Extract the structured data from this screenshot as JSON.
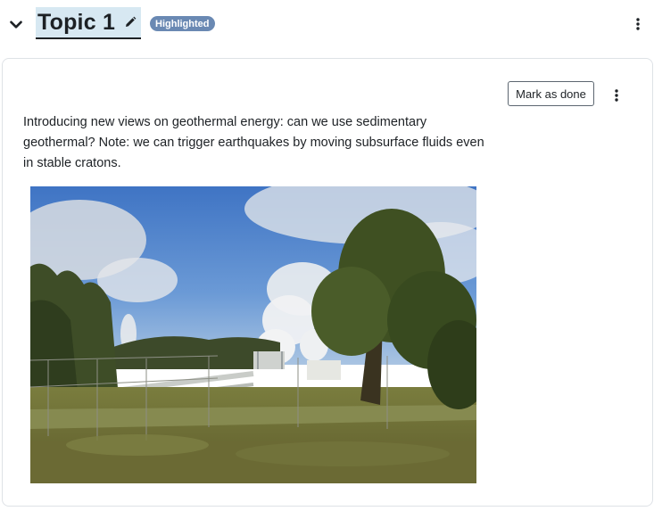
{
  "section": {
    "title": "Topic 1",
    "badge": "Highlighted",
    "collapse_icon": "chevron-down-icon",
    "edit_icon": "pencil-icon",
    "menu_icon": "kebab-menu-icon"
  },
  "activity": {
    "mark_done_label": "Mark as done",
    "menu_icon": "kebab-menu-icon",
    "description": "Introducing new views on geothermal energy: can we use sedimentary geothermal?  Note:  we can trigger earthquakes by moving subsurface fluids even in stable cratons.",
    "image_subject": "geothermal power plant with steam plumes behind a fence"
  },
  "colors": {
    "title_highlight": "#d7e8f2",
    "badge_bg": "#6a89b3",
    "text": "#1d2125",
    "card_border": "#dee2e6"
  }
}
